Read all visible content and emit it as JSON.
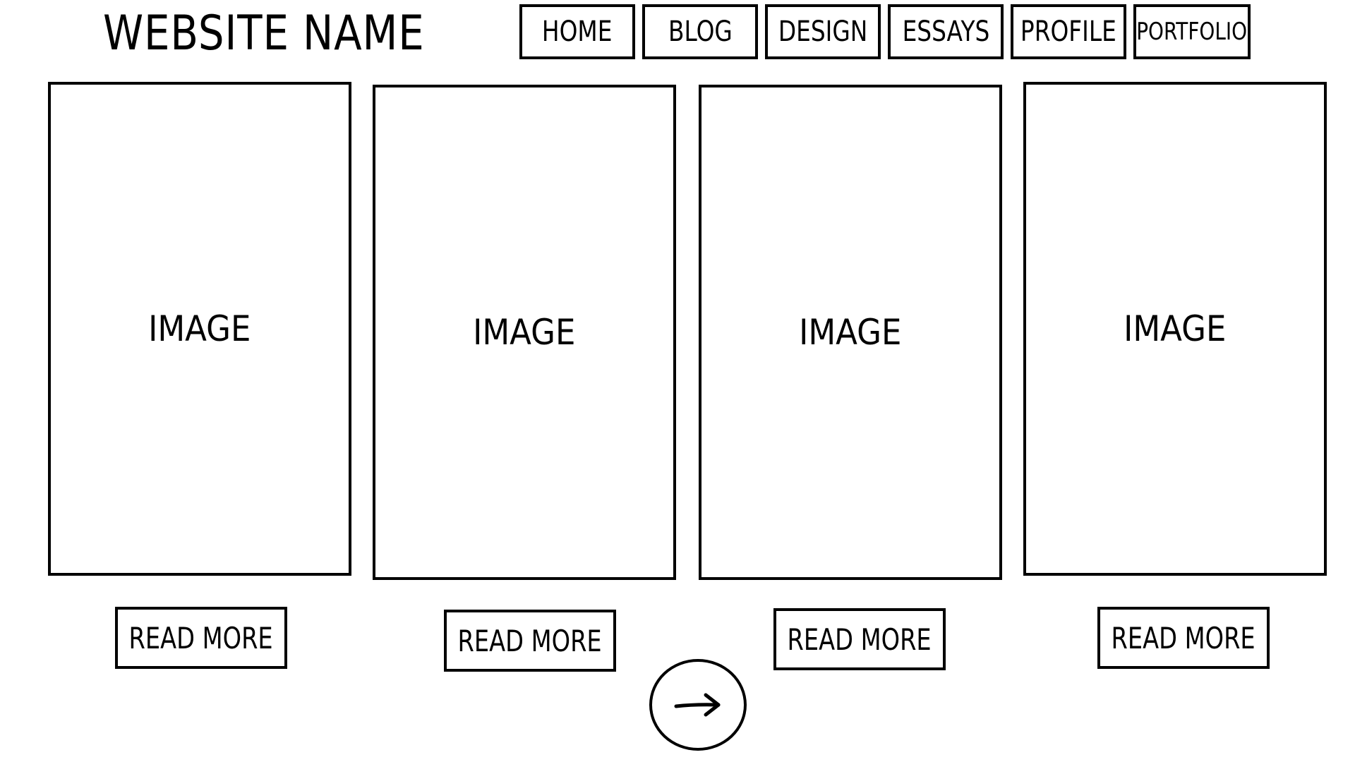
{
  "site": {
    "name": "WEBSITE NAME"
  },
  "nav": {
    "items": [
      {
        "label": "HOME"
      },
      {
        "label": "BLOG"
      },
      {
        "label": "DESIGN"
      },
      {
        "label": "ESSAYS"
      },
      {
        "label": "PROFILE"
      },
      {
        "label": "PORTFOLIO"
      }
    ]
  },
  "cards": [
    {
      "image_label": "IMAGE",
      "button_label": "READ MORE"
    },
    {
      "image_label": "IMAGE",
      "button_label": "READ MORE"
    },
    {
      "image_label": "IMAGE",
      "button_label": "READ MORE"
    },
    {
      "image_label": "IMAGE",
      "button_label": "READ MORE"
    }
  ],
  "pager": {
    "next_icon": "arrow-right-icon"
  },
  "colors": {
    "stroke": "#000000",
    "background": "#ffffff"
  }
}
